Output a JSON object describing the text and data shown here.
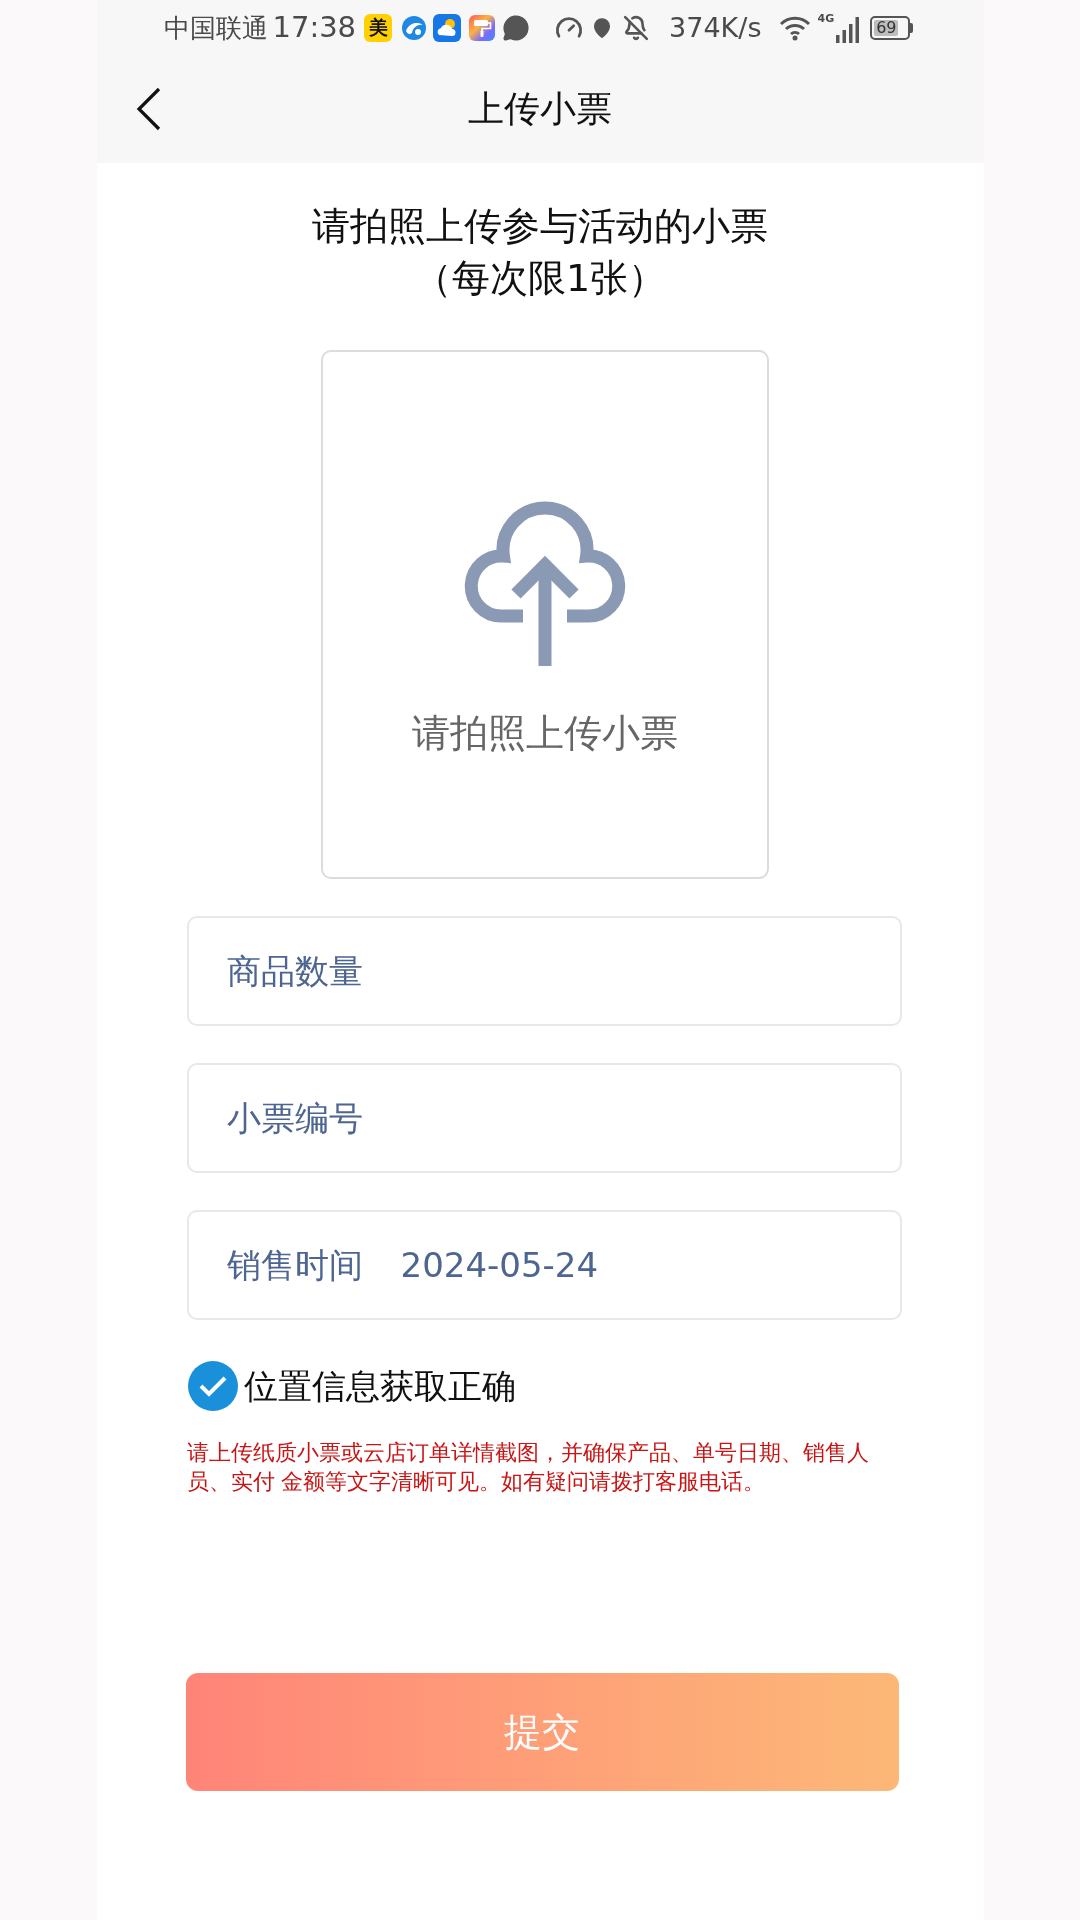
{
  "status_bar": {
    "carrier": "中国联通",
    "time": "17:38",
    "app_badge": "美",
    "net_speed": "374K/s",
    "network_type": "4G",
    "battery": "69"
  },
  "header": {
    "title": "上传小票"
  },
  "instructions": {
    "line_1": "请拍照上传参与活动的小票",
    "line_2": "（每次限1张）"
  },
  "upload_box": {
    "label": "请拍照上传小票"
  },
  "fields": [
    {
      "kind": "input",
      "placeholder": "商品数量"
    },
    {
      "kind": "input",
      "placeholder": "小票编号"
    },
    {
      "kind": "date",
      "label": "销售时间",
      "value": "2024-05-24"
    }
  ],
  "location_check": {
    "label": "位置信息获取正确",
    "checked": true
  },
  "notice": "请上传纸质小票或云店订单详情截图，并确保产品、单号日期、销售人员、实付 金额等文字清晰可见。如有疑问请拨打客服电话。",
  "submit_button": {
    "label": "提交"
  }
}
